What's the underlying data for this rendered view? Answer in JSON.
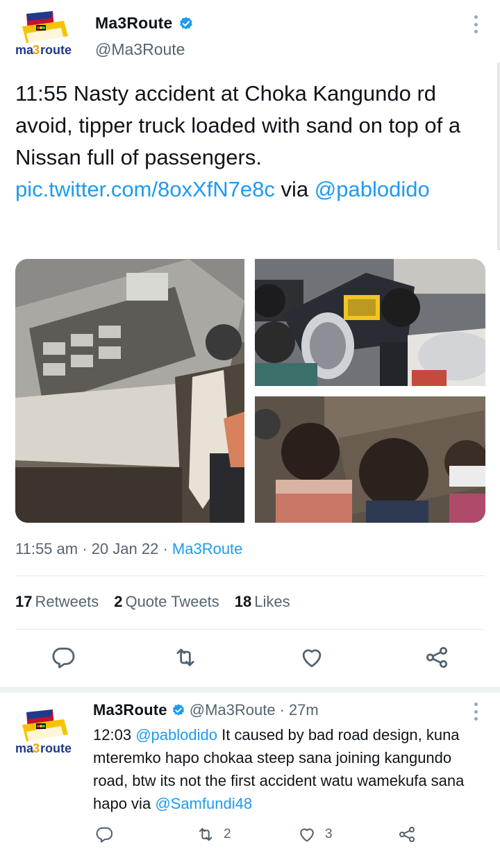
{
  "tweet": {
    "author": {
      "name": "Ma3Route",
      "handle": "@Ma3Route",
      "logo_text": "ma3route"
    },
    "text_plain": "11:55 Nasty accident at Choka Kangundo rd avoid, tipper truck loaded with sand on top of a Nissan full of passengers.",
    "link": "pic.twitter.com/8oxXfN7e8c",
    "via": "via",
    "mention": "@pablodido",
    "time": "11:55 am",
    "date": "20 Jan 22",
    "source": "Ma3Route",
    "stats": {
      "retweets_count": "17",
      "retweets_label": "Retweets",
      "quotes_count": "2",
      "quotes_label": "Quote Tweets",
      "likes_count": "18",
      "likes_label": "Likes"
    }
  },
  "reply": {
    "author": {
      "name": "Ma3Route",
      "handle": "@Ma3Route",
      "age": "27m"
    },
    "prefix": "12:03",
    "mention": "@pablodido",
    "text": "It caused by bad road design, kuna mteremko hapo chokaa steep sana joining kangundo road, btw its not the first accident watu wamekufa sana hapo via",
    "via_mention": "@Samfundi48",
    "retweets": "2",
    "likes": "3"
  },
  "icons": {
    "verified": "verified-badge-icon",
    "reply": "reply-icon",
    "retweet": "retweet-icon",
    "like": "heart-icon",
    "share": "share-icon"
  },
  "colors": {
    "link": "#1d9bf0",
    "secondary_text": "#536471",
    "primary_text": "#0f1419"
  }
}
